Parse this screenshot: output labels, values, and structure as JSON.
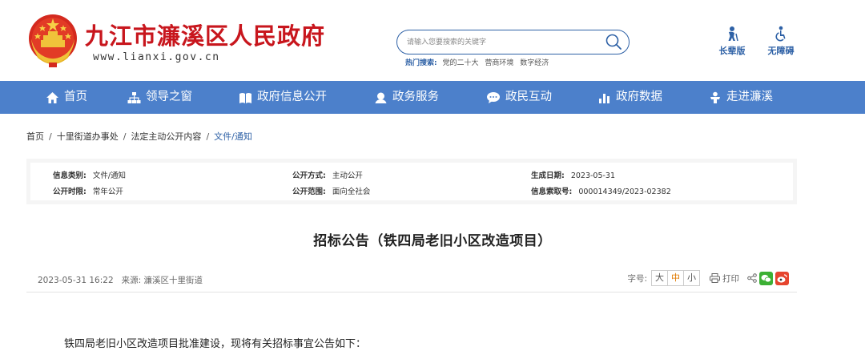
{
  "header": {
    "site_title": "九江市濂溪区人民政府",
    "site_url": "www.lianxi.gov.cn",
    "search": {
      "placeholder": "请输入您要搜索的关键字"
    },
    "hot_search": {
      "label": "热门搜索:",
      "items": [
        "党的二十大",
        "营商环境",
        "数字经济"
      ]
    },
    "tools": {
      "elder_label": "长辈版",
      "accessible_label": "无障碍"
    }
  },
  "nav": {
    "items": [
      {
        "label": "首页",
        "icon": "home-icon"
      },
      {
        "label": "领导之窗",
        "icon": "org-chart-icon"
      },
      {
        "label": "政府信息公开",
        "icon": "book-icon"
      },
      {
        "label": "政务服务",
        "icon": "service-icon"
      },
      {
        "label": "政民互动",
        "icon": "chat-icon"
      },
      {
        "label": "政府数据",
        "icon": "bar-chart-icon"
      },
      {
        "label": "走进濂溪",
        "icon": "person-icon"
      }
    ]
  },
  "breadcrumb": {
    "items": [
      "首页",
      "十里街道办事处",
      "法定主动公开内容",
      "文件/通知"
    ],
    "separator": "/"
  },
  "info": {
    "category_label": "信息类别:",
    "category_value": "文件/通知",
    "method_label": "公开方式:",
    "method_value": "主动公开",
    "date_label": "生成日期:",
    "date_value": "2023-05-31",
    "period_label": "公开时限:",
    "period_value": "常年公开",
    "scope_label": "公开范围:",
    "scope_value": "面向全社会",
    "index_label": "信息索取号:",
    "index_value": "000014349/2023-02382"
  },
  "article": {
    "title": "招标公告（铁四局老旧小区改造项目）",
    "datetime": "2023-05-31 16:22",
    "source": "来源: 濂溪区十里街道",
    "font_size_label": "字号:",
    "font_sizes": [
      "大",
      "中",
      "小"
    ],
    "active_font_size": "中",
    "print_label": "打印",
    "first_paragraph": "铁四局老旧小区改造项目批准建设，现将有关招标事宜公告如下："
  },
  "colors": {
    "brand_red": "#c8161d",
    "brand_blue": "#2e61a6",
    "nav_blue": "#4c80cb"
  }
}
